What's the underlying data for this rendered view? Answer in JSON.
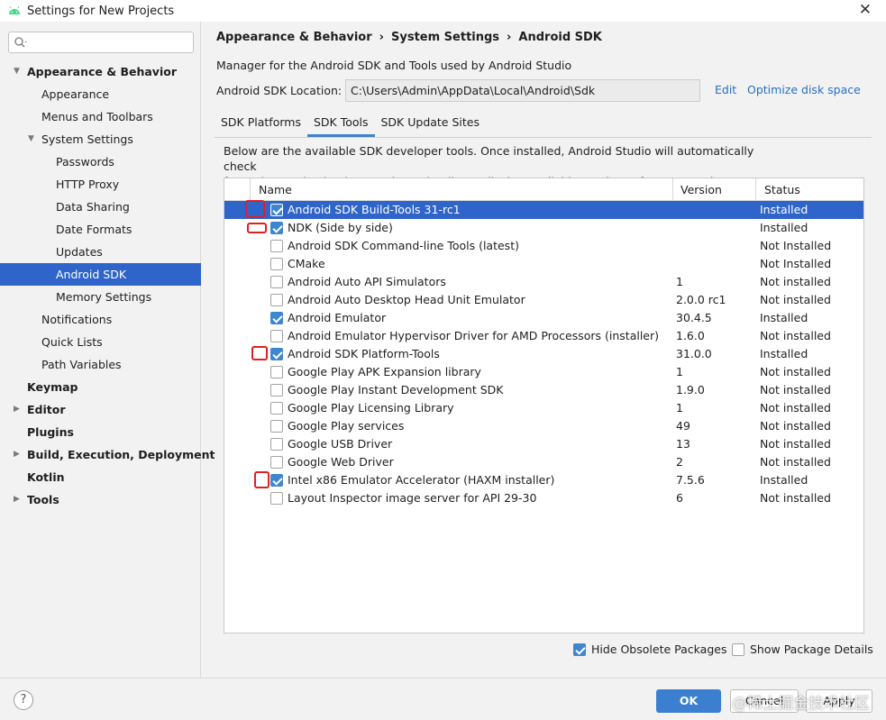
{
  "window": {
    "title": "Settings for New Projects",
    "close_glyph": "✕"
  },
  "sidebar": {
    "search_placeholder": "Q▾",
    "items": [
      {
        "label": "Appearance & Behavior",
        "level": 0,
        "bold": true,
        "arrow": "▼",
        "selected": false
      },
      {
        "label": "Appearance",
        "level": 1,
        "bold": false,
        "arrow": "",
        "selected": false
      },
      {
        "label": "Menus and Toolbars",
        "level": 1,
        "bold": false,
        "arrow": "",
        "selected": false
      },
      {
        "label": "System Settings",
        "level": 1,
        "bold": false,
        "arrow": "▼",
        "selected": false
      },
      {
        "label": "Passwords",
        "level": 2,
        "bold": false,
        "arrow": "",
        "selected": false
      },
      {
        "label": "HTTP Proxy",
        "level": 2,
        "bold": false,
        "arrow": "",
        "selected": false
      },
      {
        "label": "Data Sharing",
        "level": 2,
        "bold": false,
        "arrow": "",
        "selected": false
      },
      {
        "label": "Date Formats",
        "level": 2,
        "bold": false,
        "arrow": "",
        "selected": false
      },
      {
        "label": "Updates",
        "level": 2,
        "bold": false,
        "arrow": "",
        "selected": false
      },
      {
        "label": "Android SDK",
        "level": 2,
        "bold": false,
        "arrow": "",
        "selected": true
      },
      {
        "label": "Memory Settings",
        "level": 2,
        "bold": false,
        "arrow": "",
        "selected": false
      },
      {
        "label": "Notifications",
        "level": 1,
        "bold": false,
        "arrow": "",
        "selected": false
      },
      {
        "label": "Quick Lists",
        "level": 1,
        "bold": false,
        "arrow": "",
        "selected": false
      },
      {
        "label": "Path Variables",
        "level": 1,
        "bold": false,
        "arrow": "",
        "selected": false
      },
      {
        "label": "Keymap",
        "level": 0,
        "bold": true,
        "arrow": "",
        "selected": false
      },
      {
        "label": "Editor",
        "level": 0,
        "bold": true,
        "arrow": "▶",
        "selected": false
      },
      {
        "label": "Plugins",
        "level": 0,
        "bold": true,
        "arrow": "",
        "selected": false
      },
      {
        "label": "Build, Execution, Deployment",
        "level": 0,
        "bold": true,
        "arrow": "▶",
        "selected": false
      },
      {
        "label": "Kotlin",
        "level": 0,
        "bold": true,
        "arrow": "",
        "selected": false
      },
      {
        "label": "Tools",
        "level": 0,
        "bold": true,
        "arrow": "▶",
        "selected": false
      }
    ]
  },
  "breadcrumb": [
    "Appearance & Behavior",
    "System Settings",
    "Android SDK"
  ],
  "breadcrumb_sep": "›",
  "main": {
    "description": "Manager for the Android SDK and Tools used by Android Studio",
    "sdk_location_label": "Android SDK Location:",
    "sdk_location_value": "C:\\Users\\Admin\\AppData\\Local\\Android\\Sdk",
    "edit_link": "Edit",
    "optimize_link": "Optimize disk space",
    "tabs": [
      "SDK Platforms",
      "SDK Tools",
      "SDK Update Sites"
    ],
    "active_tab": 1,
    "info_line1": "Below are the available SDK developer tools. Once installed, Android Studio will automatically check",
    "info_line2": "for updates. Check \"show package details\" to display available versions of an SDK Tool."
  },
  "table": {
    "columns": [
      "Name",
      "Version",
      "Status"
    ],
    "rows": [
      {
        "name": "Android SDK Build-Tools 31-rc1",
        "version": "",
        "status": "Installed",
        "checked": true,
        "selected": true,
        "marked": true
      },
      {
        "name": "NDK (Side by side)",
        "version": "",
        "status": "Installed",
        "checked": true,
        "selected": false,
        "marked": true
      },
      {
        "name": "Android SDK Command-line Tools (latest)",
        "version": "",
        "status": "Not Installed",
        "checked": false,
        "selected": false,
        "marked": false
      },
      {
        "name": "CMake",
        "version": "",
        "status": "Not Installed",
        "checked": false,
        "selected": false,
        "marked": false
      },
      {
        "name": "Android Auto API Simulators",
        "version": "1",
        "status": "Not installed",
        "checked": false,
        "selected": false,
        "marked": false
      },
      {
        "name": "Android Auto Desktop Head Unit Emulator",
        "version": "2.0.0 rc1",
        "status": "Not installed",
        "checked": false,
        "selected": false,
        "marked": false
      },
      {
        "name": "Android Emulator",
        "version": "30.4.5",
        "status": "Installed",
        "checked": true,
        "selected": false,
        "marked": false
      },
      {
        "name": "Android Emulator Hypervisor Driver for AMD Processors (installer)",
        "version": "1.6.0",
        "status": "Not installed",
        "checked": false,
        "selected": false,
        "marked": false
      },
      {
        "name": "Android SDK Platform-Tools",
        "version": "31.0.0",
        "status": "Installed",
        "checked": true,
        "selected": false,
        "marked": true
      },
      {
        "name": "Google Play APK Expansion library",
        "version": "1",
        "status": "Not installed",
        "checked": false,
        "selected": false,
        "marked": false
      },
      {
        "name": "Google Play Instant Development SDK",
        "version": "1.9.0",
        "status": "Not installed",
        "checked": false,
        "selected": false,
        "marked": false
      },
      {
        "name": "Google Play Licensing Library",
        "version": "1",
        "status": "Not installed",
        "checked": false,
        "selected": false,
        "marked": false
      },
      {
        "name": "Google Play services",
        "version": "49",
        "status": "Not installed",
        "checked": false,
        "selected": false,
        "marked": false
      },
      {
        "name": "Google USB Driver",
        "version": "13",
        "status": "Not installed",
        "checked": false,
        "selected": false,
        "marked": false
      },
      {
        "name": "Google Web Driver",
        "version": "2",
        "status": "Not installed",
        "checked": false,
        "selected": false,
        "marked": false
      },
      {
        "name": "Intel x86 Emulator Accelerator (HAXM installer)",
        "version": "7.5.6",
        "status": "Installed",
        "checked": true,
        "selected": false,
        "marked": true
      },
      {
        "name": "Layout Inspector image server for API 29-30",
        "version": "6",
        "status": "Not installed",
        "checked": false,
        "selected": false,
        "marked": false
      }
    ]
  },
  "options": {
    "hide_obsolete_label": "Hide Obsolete Packages",
    "hide_obsolete_checked": true,
    "show_details_label": "Show Package Details",
    "show_details_checked": false
  },
  "footer": {
    "help_glyph": "?",
    "ok_label": "OK",
    "cancel_label": "Cancel",
    "apply_label": "Apply",
    "watermark": "@稀土掘金技术社区"
  },
  "colors": {
    "accent": "#2f65ca",
    "link": "#2470c7",
    "checkbox": "#3f86d0",
    "annotation": "#e02020"
  }
}
